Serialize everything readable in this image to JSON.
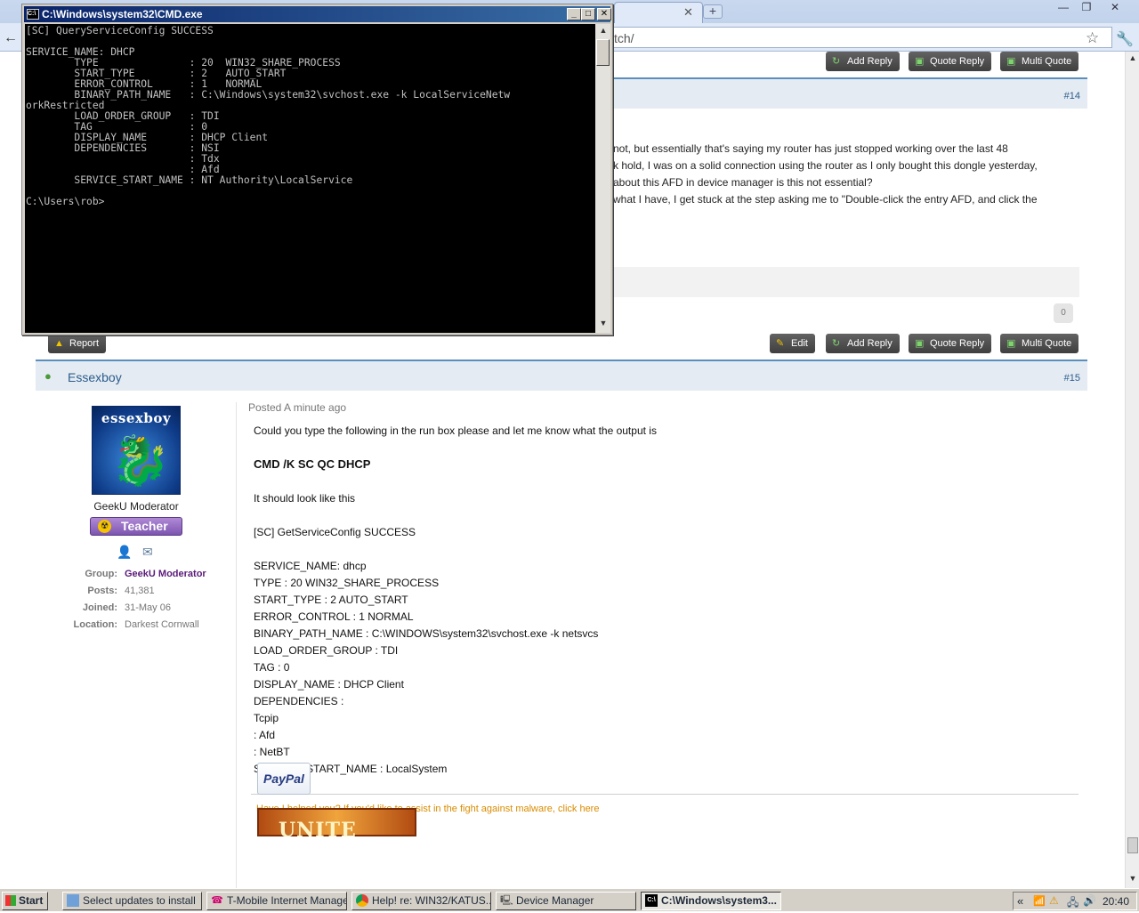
{
  "cmd": {
    "title": "C:\\Windows\\system32\\CMD.exe",
    "icon_label": "C:\\",
    "minimize": "_",
    "maximize": "□",
    "close": "✕",
    "output": "[SC] QueryServiceConfig SUCCESS\n\nSERVICE_NAME: DHCP\n        TYPE               : 20  WIN32_SHARE_PROCESS\n        START_TYPE         : 2   AUTO_START\n        ERROR_CONTROL      : 1   NORMAL\n        BINARY_PATH_NAME   : C:\\Windows\\system32\\svchost.exe -k LocalServiceNetw\norkRestricted\n        LOAD_ORDER_GROUP   : TDI\n        TAG                : 0\n        DISPLAY_NAME       : DHCP Client\n        DEPENDENCIES       : NSI\n                           : Tdx\n                           : Afd\n        SERVICE_START_NAME : NT Authority\\LocalService\n\nC:\\Users\\rob>"
  },
  "browser": {
    "tab_close": "✕",
    "new_tab": "+",
    "address_visible": "tch/",
    "back": "←",
    "window_minimize": "—",
    "window_restore": "❐",
    "window_close": "✕"
  },
  "post14": {
    "buttons": {
      "add_reply": "Add Reply",
      "quote_reply": "Quote Reply",
      "multi_quote": "Multi Quote"
    },
    "number": "#14",
    "lines": [
      "not, but essentially that's saying my router has just stopped working over the last 48",
      "k hold, I was on a solid connection using the router as I only bought this dongle yesterday,",
      "about this AFD in device manager is this not essential?",
      "what I have, I get stuck at the step asking me to \"Double-click the entry AFD, and click the"
    ],
    "like_count": "0",
    "report": "Report",
    "edit": "Edit"
  },
  "post15": {
    "author": "Essexboy",
    "number": "#15",
    "avatar_text": "essexboy",
    "title": "GeekU Moderator",
    "badge": "Teacher",
    "group_label": "Group:",
    "group_value": "GeekU Moderator",
    "posts_label": "Posts:",
    "posts_value": "41,381",
    "joined_label": "Joined:",
    "joined_value": "31-May 06",
    "location_label": "Location:",
    "location_value": "Darkest Cornwall",
    "posted": "Posted A minute ago",
    "body": [
      "Could you type the following in the run box please and let me know what the output is",
      "CMD /K SC QC DHCP",
      "It should look like this",
      "[SC] GetServiceConfig SUCCESS",
      "SERVICE_NAME: dhcp",
      "TYPE : 20 WIN32_SHARE_PROCESS",
      "START_TYPE : 2 AUTO_START",
      "ERROR_CONTROL : 1 NORMAL",
      "BINARY_PATH_NAME : C:\\WINDOWS\\system32\\svchost.exe -k netsvcs",
      "LOAD_ORDER_GROUP : TDI",
      "TAG : 0",
      "DISPLAY_NAME : DHCP Client",
      "DEPENDENCIES :",
      "Tcpip",
      ": Afd",
      ": NetBT",
      "SERVICE_START_NAME : LocalSystem"
    ],
    "signature": "Have I helped you? If you'd like to assist in the fight against malware, click here",
    "paypal": "PayPal",
    "unite": "UNITE"
  },
  "taskbar": {
    "start": "Start",
    "tasks": [
      "Select updates to install",
      "T-Mobile Internet Manager",
      "Help! re: WIN32/KATUS...",
      "Device Manager",
      "C:\\Windows\\system3..."
    ],
    "tray_arrow": "«",
    "clock": "20:40"
  },
  "colors": {
    "accent": "#5a8fbd",
    "group": "#5b1a7a",
    "signature": "#d98c00",
    "button": "#4a4a4a"
  }
}
